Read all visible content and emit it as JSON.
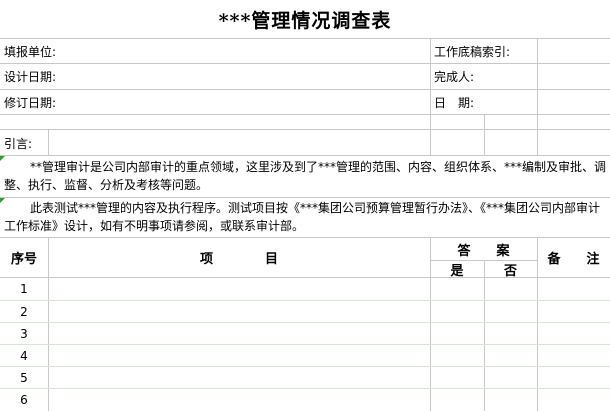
{
  "title": "***管理情况调查表",
  "info": {
    "unit_label": "填报单位:",
    "index_label": "工作底稿索引:",
    "design_date_label": "设计日期:",
    "preparer_label": "完成人:",
    "revise_date_label": "修订日期:",
    "date_label": "日　期:",
    "intro_label": "引言:"
  },
  "intro": {
    "paragraph1": "**管理审计是公司内部审计的重点领域，这里涉及到了***管理的范围、内容、组织体系、***编制及审批、调整、执行、监督、分析及考核等问题。",
    "paragraph2": "此表测试***管理的内容及执行程序。测试项目按《***集团公司预算管理暂行办法》、《***集团公司内部审计工作标准》设计，如有不明事项请参阅，或联系审计部。"
  },
  "table": {
    "col_no": "序号",
    "col_item": "项　　　　目",
    "col_answer": "答　　案",
    "col_yes": "是",
    "col_no_answer": "否",
    "col_remark": "备　　注",
    "rows": [
      "1",
      "2",
      "3",
      "4",
      "5",
      "6"
    ]
  }
}
